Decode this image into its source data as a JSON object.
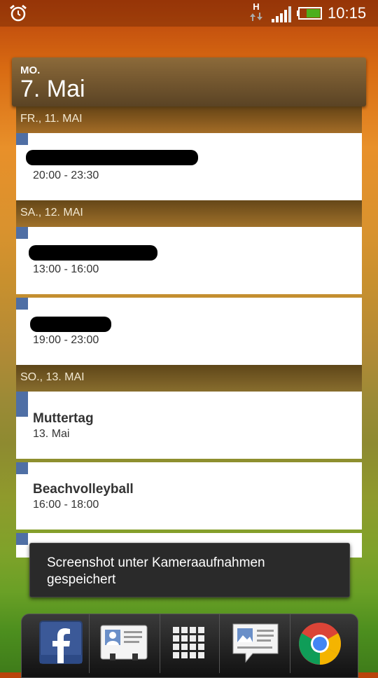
{
  "status": {
    "network_type": "H",
    "time": "10:15"
  },
  "widget": {
    "weekday": "MO.",
    "date": "7. Mai"
  },
  "agenda": {
    "days": [
      {
        "label": "FR., 11. MAI"
      },
      {
        "label": "SA., 12. MAI"
      },
      {
        "label": "SO., 13. MAI"
      }
    ],
    "events": [
      {
        "title_redacted": true,
        "time": "20:00 - 23:30"
      },
      {
        "title_redacted": true,
        "time": "13:00 - 16:00"
      },
      {
        "title_redacted": true,
        "time": "19:00 - 23:00"
      },
      {
        "title": "Muttertag",
        "time": "13. Mai"
      },
      {
        "title": "Beachvolleyball",
        "time": "16:00 - 18:00"
      }
    ]
  },
  "toast": {
    "message": "Screenshot unter Kameraaufnahmen gespeichert"
  },
  "dock": {
    "apps": [
      {
        "icon": "facebook-icon"
      },
      {
        "icon": "contacts-icon"
      },
      {
        "icon": "app-drawer-icon"
      },
      {
        "icon": "messages-icon"
      },
      {
        "icon": "chrome-icon"
      }
    ]
  },
  "colors": {
    "event_marker": "#4f6fa5",
    "toast_bg": "#2a2a2a"
  }
}
